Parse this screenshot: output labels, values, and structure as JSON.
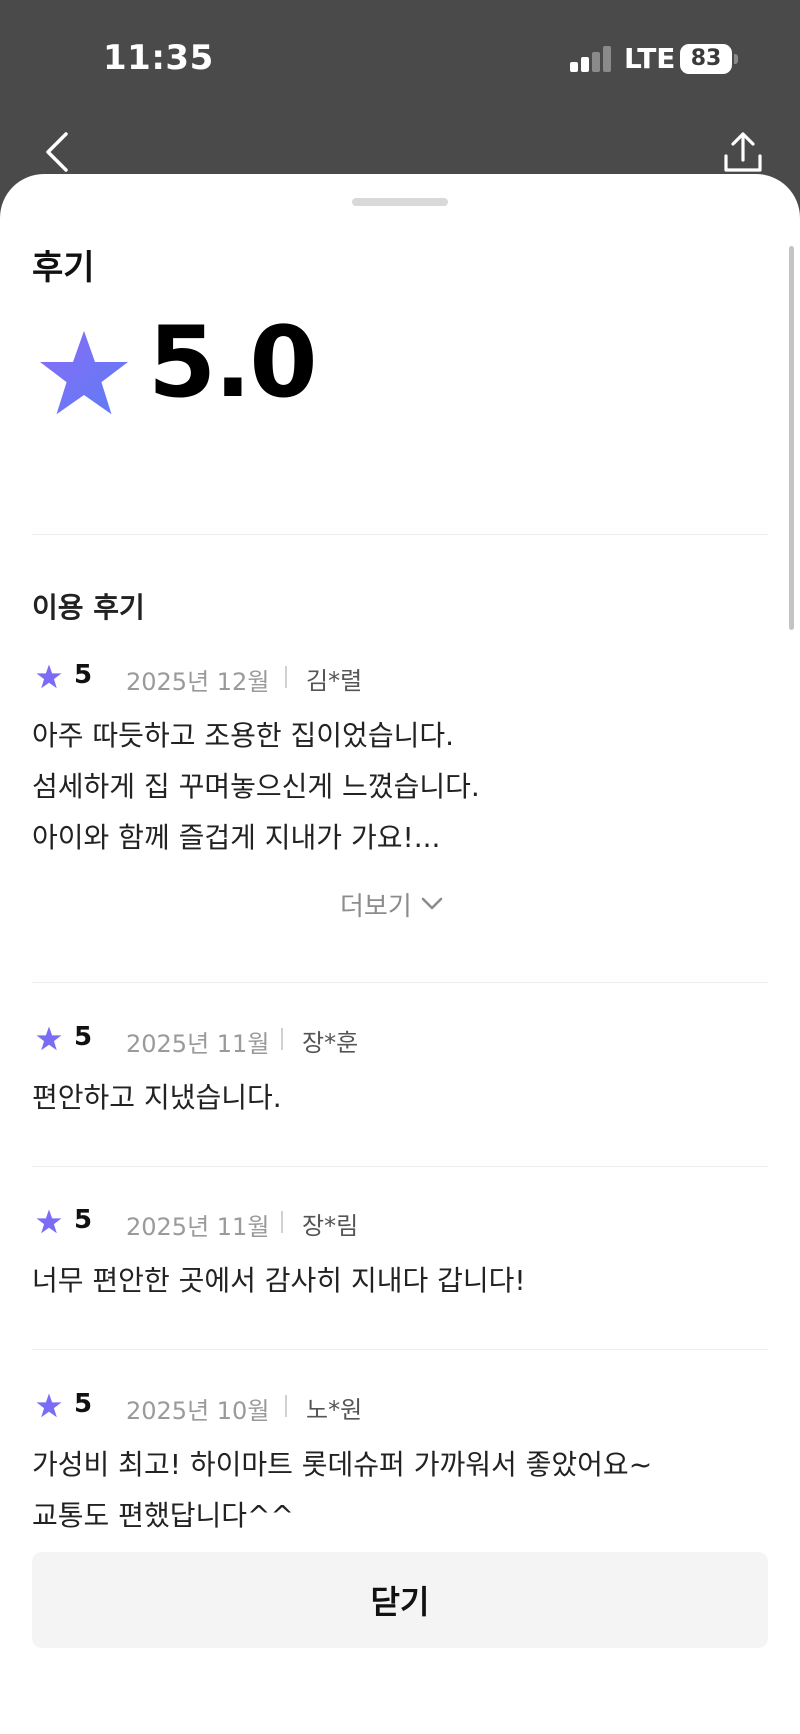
{
  "status_bar": {
    "time": "11:35",
    "network": "LTE",
    "battery": "83"
  },
  "header": {
    "back_icon": "chevron-left-icon",
    "share_icon": "share-icon"
  },
  "sheet": {
    "title": "후기",
    "rating": "5.0",
    "section_title": "이용 후기",
    "accent_color": "#7b6cf6",
    "reviews": [
      {
        "score": "5",
        "date": "2025년 12월",
        "author": "김*렬",
        "body": "아주 따듯하고 조용한 집이었습니다.\n섬세하게 집 꾸며놓으신게 느꼈습니다.\n아이와 함께 즐겁게 지내가 가요!..."
      },
      {
        "score": "5",
        "date": "2025년 11월",
        "author": "장*훈",
        "body": "편안하고 지냈습니다."
      },
      {
        "score": "5",
        "date": "2025년 11월",
        "author": "장*림",
        "body": "너무 편안한 곳에서 감사히 지내다 갑니다!"
      },
      {
        "score": "5",
        "date": "2025년 10월",
        "author": "노*원",
        "body": "가성비 최고! 하이마트 롯데슈퍼 가까워서 좋았어요~\n교통도 편했답니다^^"
      }
    ],
    "more_label": "더보기",
    "close_label": "닫기"
  }
}
